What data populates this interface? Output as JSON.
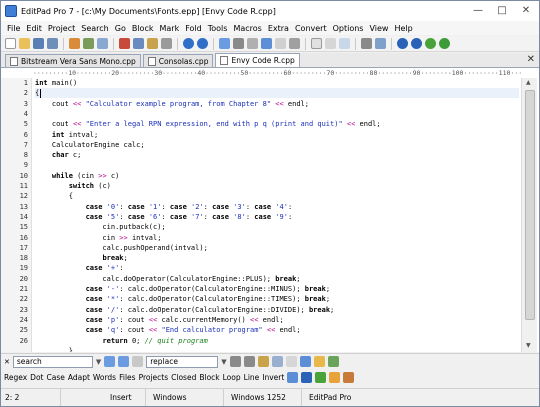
{
  "window": {
    "title": "EditPad Pro 7 - [c:\\My Documents\\Fonts.epp] [Envy Code R.cpp]"
  },
  "menu": [
    "File",
    "Edit",
    "Project",
    "Search",
    "Go",
    "Block",
    "Mark",
    "Fold",
    "Tools",
    "Macros",
    "Extra",
    "Convert",
    "Options",
    "View",
    "Help"
  ],
  "tabs": [
    {
      "label": "Bitstream Vera Sans Mono.cpp",
      "active": false
    },
    {
      "label": "Consolas.cpp",
      "active": false
    },
    {
      "label": "Envy Code R.cpp",
      "active": true
    }
  ],
  "ruler": "·········10·········20·········30·········40·········50·········60·········70·········80·········90········100·········110·········120",
  "code": {
    "current_line": 2,
    "lines": [
      "int main()",
      "{",
      "    cout << \"Calculator example program, from Chapter 8\" << endl;",
      "",
      "    cout << \"Enter a legal RPN expression, end with p q (print and quit)\" << endl;",
      "    int intval;",
      "    CalculatorEngine calc;",
      "    char c;",
      "",
      "    while (cin >> c)",
      "        switch (c)",
      "        {",
      "            case '0': case '1': case '2': case '3': case '4':",
      "            case '5': case '6': case '7': case '8': case '9':",
      "                cin.putback(c);",
      "                cin >> intval;",
      "                calc.pushOperand(intval);",
      "                break;",
      "            case '+':",
      "                calc.doOperator(CalculatorEngine::PLUS); break;",
      "            case '-': calc.doOperator(CalculatorEngine::MINUS); break;",
      "            case '*': calc.doOperator(CalculatorEngine::TIMES); break;",
      "            case '/': calc.doOperator(CalculatorEngine::DIVIDE); break;",
      "            case 'p': cout << calc.currentMemory() << endl;",
      "            case 'q': cout << \"End calculator program\" << endl;",
      "                return 0; // quit program"
    ],
    "partial_last_line": "        }"
  },
  "search": {
    "search_value": "search",
    "replace_value": "replace"
  },
  "options": [
    "Regex",
    "Dot",
    "Case",
    "Adapt",
    "Words",
    "Files",
    "Projects",
    "Closed",
    "Block",
    "Loop",
    "Line",
    "Invert"
  ],
  "status": {
    "position": "2: 2",
    "mode": "Insert",
    "line_breaks": "Windows",
    "encoding": "Windows 1252",
    "app": "EditPad Pro"
  },
  "colors": {
    "string": "#1b2fb8",
    "comment": "#1b7d1b",
    "keyword": "#000000",
    "current_line_bg": "#eaf1fb"
  }
}
